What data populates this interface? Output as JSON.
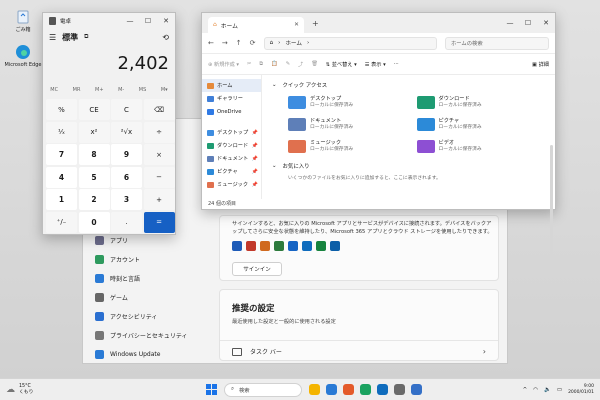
{
  "desktop": {
    "icons": [
      {
        "label": "ごみ箱",
        "icon": "recycle-bin-icon"
      },
      {
        "label": "Microsoft Edge",
        "icon": "edge-icon"
      }
    ]
  },
  "calculator": {
    "title": "電卓",
    "mode": "標準",
    "display": "2,402",
    "memory": [
      "MC",
      "MR",
      "M+",
      "M-",
      "MS",
      "M▾"
    ],
    "keys": [
      "%",
      "CE",
      "C",
      "⌫",
      "¹⁄ₓ",
      "x²",
      "²√x",
      "÷",
      "7",
      "8",
      "9",
      "×",
      "4",
      "5",
      "6",
      "−",
      "1",
      "2",
      "3",
      "+",
      "⁺/₋",
      "0",
      ".",
      "="
    ],
    "accent": "#1660c4"
  },
  "explorer": {
    "tab_title": "ホーム",
    "address": "ホーム",
    "search_placeholder": "ホームの検索",
    "new_label": "新規作成",
    "sort_label": "並べ替え",
    "view_label": "表示",
    "details_label": "詳細",
    "sidebar": [
      {
        "label": "ホーム",
        "color": "#e58a3b",
        "pinned": false
      },
      {
        "label": "ギャラリー",
        "color": "#3f7fd8",
        "pinned": false
      },
      {
        "label": "OneDrive",
        "color": "#2f7ae5",
        "pinned": false
      },
      {
        "label": "デスクトップ",
        "color": "#3e8de0",
        "pinned": true
      },
      {
        "label": "ダウンロード",
        "color": "#1e9b72",
        "pinned": true
      },
      {
        "label": "ドキュメント",
        "color": "#5e7fb8",
        "pinned": true
      },
      {
        "label": "ピクチャ",
        "color": "#2c8ad8",
        "pinned": true
      },
      {
        "label": "ミュージック",
        "color": "#e0704e",
        "pinned": true
      }
    ],
    "quick_access_title": "クイック アクセス",
    "quick_access": [
      {
        "name": "デスクトップ",
        "sub": "ローカルに保存済み",
        "color": "#3e8de0"
      },
      {
        "name": "ダウンロード",
        "sub": "ローカルに保存済み",
        "color": "#1e9b72"
      },
      {
        "name": "ドキュメント",
        "sub": "ローカルに保存済み",
        "color": "#5e7fb8"
      },
      {
        "name": "ピクチャ",
        "sub": "ローカルに保存済み",
        "color": "#2c8ad8"
      },
      {
        "name": "ミュージック",
        "sub": "ローカルに保存済み",
        "color": "#e0704e"
      },
      {
        "name": "ビデオ",
        "sub": "ローカルに保存済み",
        "color": "#8d4fd3"
      }
    ],
    "favorites_title": "お気に入り",
    "favorites_note": "いくつかのファイルをお気に入りに追加すると、ここに表示されます。",
    "status": "24 個の項目"
  },
  "settings": {
    "nav": [
      {
        "label": "アプリ",
        "color": "#6b6b8a"
      },
      {
        "label": "アカウント",
        "color": "#2e9a5e"
      },
      {
        "label": "時刻と言語",
        "color": "#2a7ad5"
      },
      {
        "label": "ゲーム",
        "color": "#666666"
      },
      {
        "label": "アクセシビリティ",
        "color": "#2a6fd0"
      },
      {
        "label": "プライバシーとセキュリティ",
        "color": "#777777"
      },
      {
        "label": "Windows Update",
        "color": "#2a7ad5"
      }
    ],
    "signin_desc": "サインインすると、お気に入りの Microsoft アプリとサービスがデバイスに接続されます。デバイスをバックアップしてさらに安全な状態を維持したり、Microsoft 365 アプリとクラウド ストレージを使用したりできます。",
    "signin_button": "サインイン",
    "app_colors": [
      "#1e5bb8",
      "#c2392b",
      "#d06a1f",
      "#2d7a3c",
      "#1664c4",
      "#0f6cbd",
      "#17833e",
      "#0b5ea8"
    ],
    "recommended_title": "推奨の設定",
    "recommended_sub": "最近使用した設定と一般的に使用される設定",
    "taskbar_item": "タスク バー"
  },
  "taskbar": {
    "temp": "15°C",
    "weather": "くもり",
    "search_placeholder": "検索",
    "time": "9:00",
    "date": "2000/01/01",
    "app_colors": [
      "#f4b400",
      "#2a7ad5",
      "#e45a2a",
      "#1aa260",
      "#0f6cbd",
      "#6a6a6a",
      "#3470c7"
    ]
  }
}
